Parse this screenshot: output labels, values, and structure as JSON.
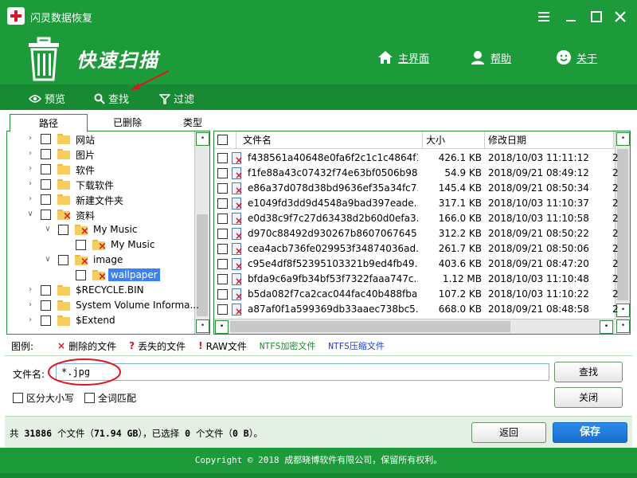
{
  "app": {
    "title": "闪灵数据恢复",
    "subtitle": "快速扫描",
    "brand_color": "#1d9b3b"
  },
  "header_nav": {
    "home": "主界面",
    "help": "帮助",
    "about": "关于"
  },
  "toolbar": {
    "preview": "预览",
    "find": "查找",
    "filter": "过滤"
  },
  "tabs": {
    "path": "路径",
    "deleted": "已删除",
    "type": "类型"
  },
  "tree": [
    {
      "label": "网站",
      "level": 0,
      "deleted": false,
      "expand": "collapsed"
    },
    {
      "label": "图片",
      "level": 0,
      "deleted": false,
      "expand": "collapsed"
    },
    {
      "label": "软件",
      "level": 0,
      "deleted": false,
      "expand": "collapsed"
    },
    {
      "label": "下载软件",
      "level": 0,
      "deleted": false,
      "expand": "collapsed"
    },
    {
      "label": "新建文件夹",
      "level": 0,
      "deleted": false,
      "expand": "collapsed"
    },
    {
      "label": "资料",
      "level": 0,
      "deleted": true,
      "expand": "expanded"
    },
    {
      "label": "My Music",
      "level": 1,
      "deleted": true,
      "expand": "expanded"
    },
    {
      "label": "My Music",
      "level": 2,
      "deleted": true,
      "expand": "none"
    },
    {
      "label": "image",
      "level": 1,
      "deleted": true,
      "expand": "expanded"
    },
    {
      "label": "wallpaper",
      "level": 2,
      "deleted": true,
      "expand": "none",
      "selected": true
    },
    {
      "label": "$RECYCLE.BIN",
      "level": 0,
      "deleted": false,
      "expand": "collapsed"
    },
    {
      "label": "System Volume Informa...",
      "level": 0,
      "deleted": false,
      "expand": "collapsed"
    },
    {
      "label": "$Extend",
      "level": 0,
      "deleted": false,
      "expand": "collapsed"
    }
  ],
  "file_list": {
    "columns": {
      "name": "文件名",
      "size": "大小",
      "date": "修改日期"
    },
    "rows": [
      {
        "name": "f438561a40648e0fa6f2c1c1c4864f1...",
        "size": "426.1 KB",
        "date": "2018/10/03 11:11:12",
        "extra": "2"
      },
      {
        "name": "f1fe88a43c07432f74e63bf0506b98...",
        "size": "54.9 KB",
        "date": "2018/09/21 08:49:12",
        "extra": "2"
      },
      {
        "name": "e86a37d078d38bd9636ef35a34fc7...",
        "size": "145.4 KB",
        "date": "2018/09/21 08:50:34",
        "extra": "2"
      },
      {
        "name": "e1049fd3dd9d4548a9bad397eade...",
        "size": "317.1 KB",
        "date": "2018/10/03 11:10:37",
        "extra": "2"
      },
      {
        "name": "e0d38c9f7c27d63438d2b60d0efa3...",
        "size": "166.0 KB",
        "date": "2018/10/03 11:10:58",
        "extra": "2"
      },
      {
        "name": "d970c88492d930267b8607067645...",
        "size": "312.2 KB",
        "date": "2018/09/21 08:50:22",
        "extra": "2"
      },
      {
        "name": "cea4acb736fe029953f34874036ad...",
        "size": "261.7 KB",
        "date": "2018/09/21 08:50:06",
        "extra": "2"
      },
      {
        "name": "c95e4df8f52395103321b9ed4fb49...",
        "size": "403.6 KB",
        "date": "2018/09/21 08:47:20",
        "extra": "2"
      },
      {
        "name": "bfda9c6a9fb34bf53f7322faaa747c...",
        "size": "1.12 MB",
        "date": "2018/10/03 11:10:48",
        "extra": "2"
      },
      {
        "name": "b5da082f7ca2cac044fac40b488fba...",
        "size": "107.2 KB",
        "date": "2018/10/03 11:10:22",
        "extra": "2"
      },
      {
        "name": "a87af0f1a599369db33aaec738bc5...",
        "size": "668.0 KB",
        "date": "2018/09/21 08:48:58",
        "extra": "2"
      }
    ]
  },
  "legend": {
    "title": "图例:",
    "deleted": "删除的文件",
    "lost": "丢失的文件",
    "raw": "RAW文件",
    "ntfs_encrypt": "NTFS加密文件",
    "ntfs_compress": "NTFS压缩文件"
  },
  "search": {
    "label": "文件名:",
    "value": "*.jpg",
    "find_button": "查找",
    "close_button": "关闭",
    "case_sensitive": "区分大小写",
    "whole_word": "全词匹配"
  },
  "status": {
    "prefix": "共",
    "total": "31886",
    "mid1": "个文件（",
    "size": "71.94 GB",
    "mid2": "），已选择",
    "selected": "0",
    "mid3": "个文件（",
    "selected_size": "0 B",
    "suffix": "）。"
  },
  "buttons": {
    "back": "返回",
    "save": "保存"
  },
  "footer": {
    "copyright": "Copyright © 2018 成都晓博软件有限公司，保留所有权利。"
  }
}
